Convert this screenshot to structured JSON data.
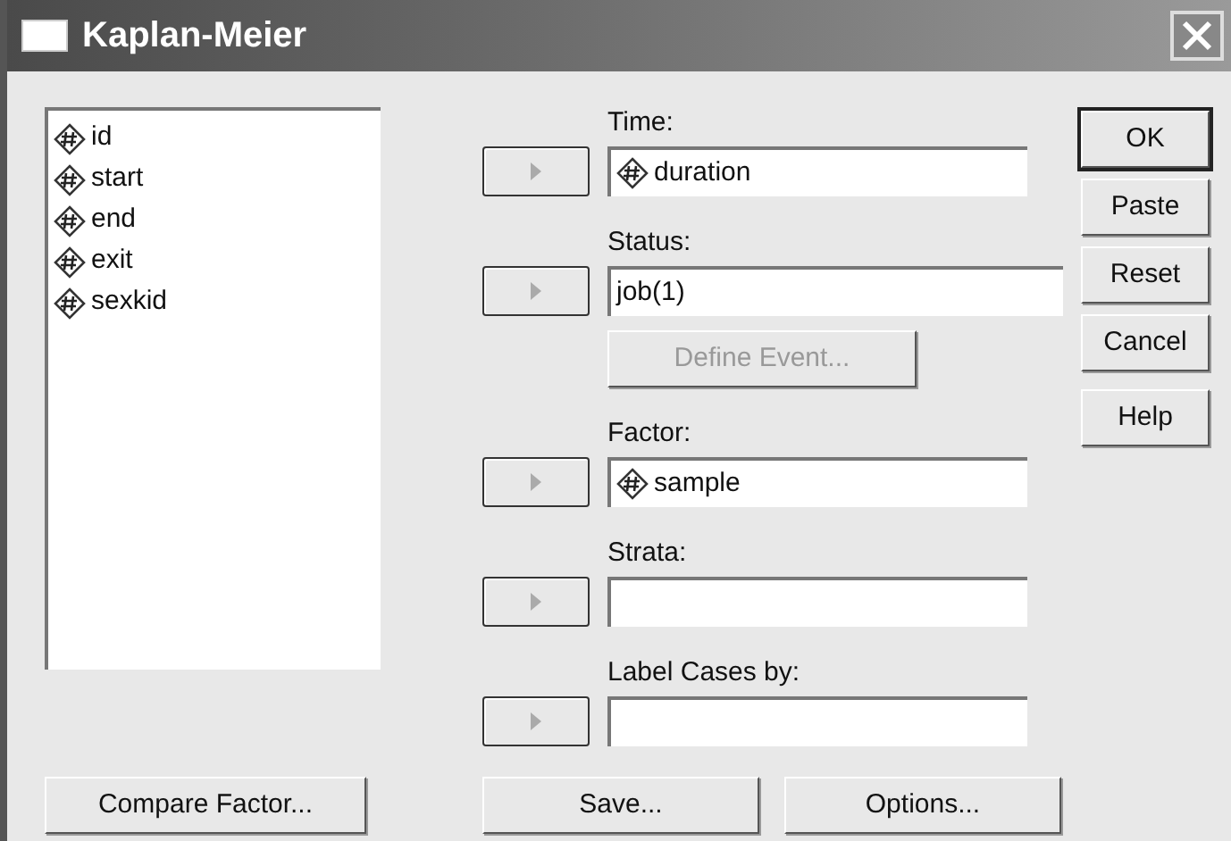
{
  "window": {
    "title": "Kaplan-Meier"
  },
  "variables": [
    {
      "name": "id"
    },
    {
      "name": "start"
    },
    {
      "name": "end"
    },
    {
      "name": "exit"
    },
    {
      "name": "sexkid"
    }
  ],
  "targets": [
    {
      "label": "Time:",
      "value": "duration",
      "kind": "variable"
    },
    {
      "label": "Status:",
      "value": "job(1)",
      "kind": "text",
      "button": {
        "label": "Define Event...",
        "disabled": true
      }
    },
    {
      "label": "Factor:",
      "value": "sample",
      "kind": "variable"
    },
    {
      "label": "Strata:",
      "kind": "empty"
    },
    {
      "label": "Label Cases by:",
      "kind": "empty"
    }
  ],
  "side_buttons": [
    {
      "label": "OK",
      "default": true
    },
    {
      "label": "Paste",
      "default": false
    },
    {
      "label": "Reset",
      "default": false
    },
    {
      "label": "Cancel",
      "default": false
    },
    {
      "label": "Help",
      "default": false
    }
  ],
  "bottom_buttons": [
    "Compare Factor...",
    "Save...",
    "Options..."
  ]
}
